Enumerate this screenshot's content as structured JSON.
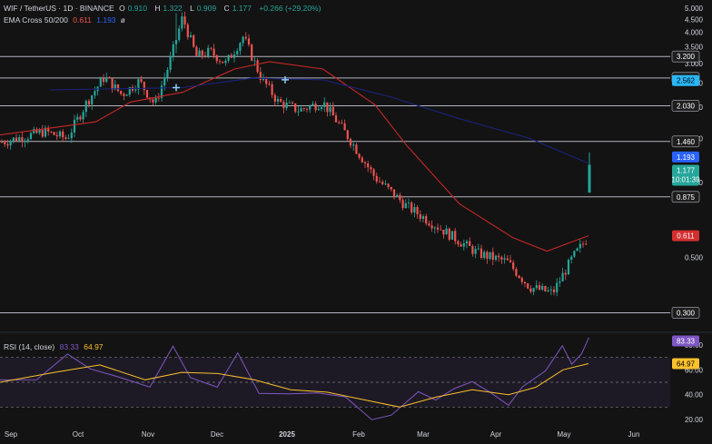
{
  "header": {
    "symbol": "WIF / TetherUS · 1D · BINANCE",
    "o_label": "O",
    "o": "0.910",
    "h_label": "H",
    "h": "1.322",
    "l_label": "L",
    "l": "0.909",
    "c_label": "C",
    "c": "1.177",
    "change": "+0.266 (+29.20%)"
  },
  "ema_legend": {
    "label": "EMA Cross 50/200",
    "v1": "0.611",
    "v2": "1.193",
    "eye": "ø"
  },
  "rsi_legend": {
    "label": "RSI (14, close)",
    "v1": "83.33",
    "v2": "64.97"
  },
  "colors": {
    "background": "#131313",
    "up": "#26a69a",
    "down": "#ef5350",
    "ema_fast": "#c62828",
    "ema_slow": "#1a237e",
    "rsi": "#7e57c2",
    "rsi_ma": "#fbc02d",
    "hline": "#b2b5be",
    "price_badge": "#26a69a",
    "ema_badge": "#2962ff"
  },
  "chart_data": {
    "type": "candlestick",
    "scale": "log",
    "x_ticks": [
      "Sep",
      "Oct",
      "Nov",
      "Dec",
      "2025",
      "Feb",
      "Mar",
      "Apr",
      "May",
      "Jun"
    ],
    "y_ticks": [
      "5.000",
      "4.500",
      "4.000",
      "3.500",
      "3.000",
      "2.500",
      "2.000",
      "1.500",
      "1.000",
      "0.500"
    ],
    "horizontal_levels": [
      "3.200",
      "2.625",
      "2.030",
      "1.460",
      "0.875",
      "0.300"
    ],
    "price_label": {
      "value": "1.177",
      "countdown": "10:01:39"
    },
    "ema_labels": {
      "slow": "1.193",
      "fast": "0.611",
      "cross_value": "2.562"
    },
    "anchor_points": [
      [
        "Sep",
        1.45
      ],
      [
        "Sep",
        1.6
      ],
      [
        "Sep",
        1.5
      ],
      [
        "Oct",
        2.1
      ],
      [
        "Oct",
        2.65
      ],
      [
        "Oct",
        2.25
      ],
      [
        "Oct",
        2.55
      ],
      [
        "Nov",
        2.05
      ],
      [
        "Nov",
        2.95
      ],
      [
        "Nov",
        4.6
      ],
      [
        "Nov",
        3.2
      ],
      [
        "Nov",
        3.35
      ],
      [
        "Dec",
        3.0
      ],
      [
        "Dec",
        3.85
      ],
      [
        "Dec",
        2.65
      ],
      [
        "Dec",
        2.1
      ],
      [
        "2025",
        1.95
      ],
      [
        "2025",
        2.1
      ],
      [
        "2025",
        1.55
      ],
      [
        "Feb",
        1.05
      ],
      [
        "Feb",
        0.8
      ],
      [
        "Mar",
        0.65
      ],
      [
        "Mar",
        0.52
      ],
      [
        "Apr",
        0.48
      ],
      [
        "Apr",
        0.38
      ],
      [
        "Apr",
        0.36
      ],
      [
        "May",
        0.5
      ],
      [
        "May",
        0.62
      ],
      [
        "May",
        0.91
      ],
      [
        "May",
        1.177
      ]
    ],
    "ema_fast": [
      [
        "Sep",
        1.55
      ],
      [
        "Oct",
        1.75
      ],
      [
        "Oct",
        2.1
      ],
      [
        "Nov",
        2.3
      ],
      [
        "Dec",
        2.85
      ],
      [
        "Dec",
        3.05
      ],
      [
        "2025",
        2.85
      ],
      [
        "Feb",
        2.05
      ],
      [
        "Feb",
        1.4
      ],
      [
        "Mar",
        0.82
      ],
      [
        "Apr",
        0.6
      ],
      [
        "Apr",
        0.53
      ],
      [
        "May",
        0.611
      ]
    ],
    "ema_slow": [
      [
        "Oct",
        2.35
      ],
      [
        "Nov",
        2.4
      ],
      [
        "Dec",
        2.62
      ],
      [
        "2025",
        2.58
      ],
      [
        "Feb",
        2.2
      ],
      [
        "Mar",
        1.8
      ],
      [
        "Apr",
        1.5
      ],
      [
        "May",
        1.193
      ]
    ],
    "rsi": {
      "levels": [
        "80.00",
        "60.00",
        "40.00",
        "20.00"
      ],
      "rsi_value": "83.33",
      "ma_value": "64.97"
    }
  }
}
